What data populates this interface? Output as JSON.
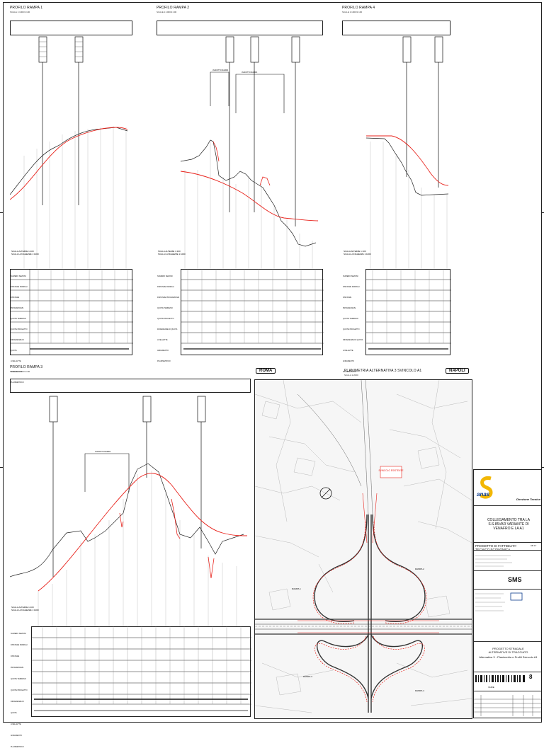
{
  "profiles": [
    {
      "title": "PROFILO RAMPA 1",
      "subtitle": "SCALE 1:1000/1:100"
    },
    {
      "title": "PROFILO RAMPA 2",
      "subtitle": "SCALE 1:1000/1:100"
    },
    {
      "title": "PROFILO RAMPA 4",
      "subtitle": "SCALE 1:1000/1:100"
    },
    {
      "title": "PROFILO RAMPA 3",
      "subtitle": "SCALE 1:1000/1:100"
    }
  ],
  "plan": {
    "title": "PLANIMETRIA ALTERNATIVA 3 SVINCOLO A1",
    "subtitle": "SCALA 1:2000",
    "direction_left": "ROMA",
    "direction_right": "NAPOLI",
    "label_svincolo": "SVINCOLO ESISTENTE",
    "ramp_labels": [
      "RAMPA 1",
      "RAMPA 2",
      "RAMPA 3",
      "RAMPA 4"
    ]
  },
  "structure_labels": [
    "VIADOTTO RAMPA",
    "VIADOTTO RAMPA",
    "VIADOTTO RAMPA"
  ],
  "table_labels": [
    "NUMERO SEZIONI",
    "DISTANZE PARZIALI",
    "DISTANZE PROGRESSIVE",
    "QUOTE TERRENO",
    "QUOTE PROGETTO",
    "DIFFERENZE DI QUOTA",
    "LIVELLETTE",
    "ANDAMENTO PLANIMETRICO"
  ],
  "title_block": {
    "brand": "anas",
    "division": "Direzione Tecnica",
    "project_title": "COLLEGAMENTO TRA LA S.S.85VAR VARIANTE DI VENAFRO E LA A1",
    "project_type": "PROGETTO DI FATTIBILITA' TECNICO ECONOMICA",
    "code": "CB 17",
    "designer": "SMS",
    "drawing_title_1": "PROGETTO STRADALE",
    "drawing_title_2": "ALTERNATIVE DI TRACCIATO",
    "drawing_title_3": "Alternativa 3 - Planimetria e Profili Svincolo A1",
    "scale": "VARIE",
    "sheet": "8"
  },
  "colors": {
    "profile_design": "#e8231c",
    "terrain": "#222222"
  }
}
